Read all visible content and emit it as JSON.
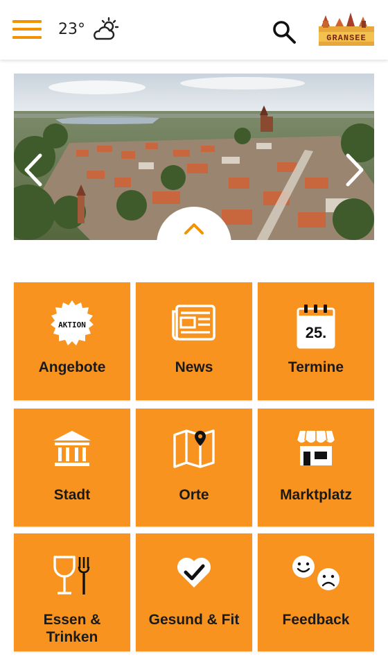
{
  "header": {
    "temperature": "23°",
    "weather_icon": "partly-cloudy-icon",
    "logo_text": "GRANSEE"
  },
  "calendar_day": "25.",
  "offers_badge": "AKTION",
  "tiles": [
    {
      "label": "Angebote",
      "icon": "aktion-badge-icon"
    },
    {
      "label": "News",
      "icon": "newspaper-icon"
    },
    {
      "label": "Termine",
      "icon": "calendar-icon"
    },
    {
      "label": "Stadt",
      "icon": "town-hall-icon"
    },
    {
      "label": "Orte",
      "icon": "map-pin-icon"
    },
    {
      "label": "Marktplatz",
      "icon": "shop-icon"
    },
    {
      "label": "Essen & Trinken",
      "icon": "glass-fork-icon"
    },
    {
      "label": "Gesund & Fit",
      "icon": "heart-check-icon"
    },
    {
      "label": "Feedback",
      "icon": "smileys-icon"
    }
  ],
  "colors": {
    "accent": "#F39200",
    "tile": "#F7931E",
    "text": "#1A1A1A"
  }
}
